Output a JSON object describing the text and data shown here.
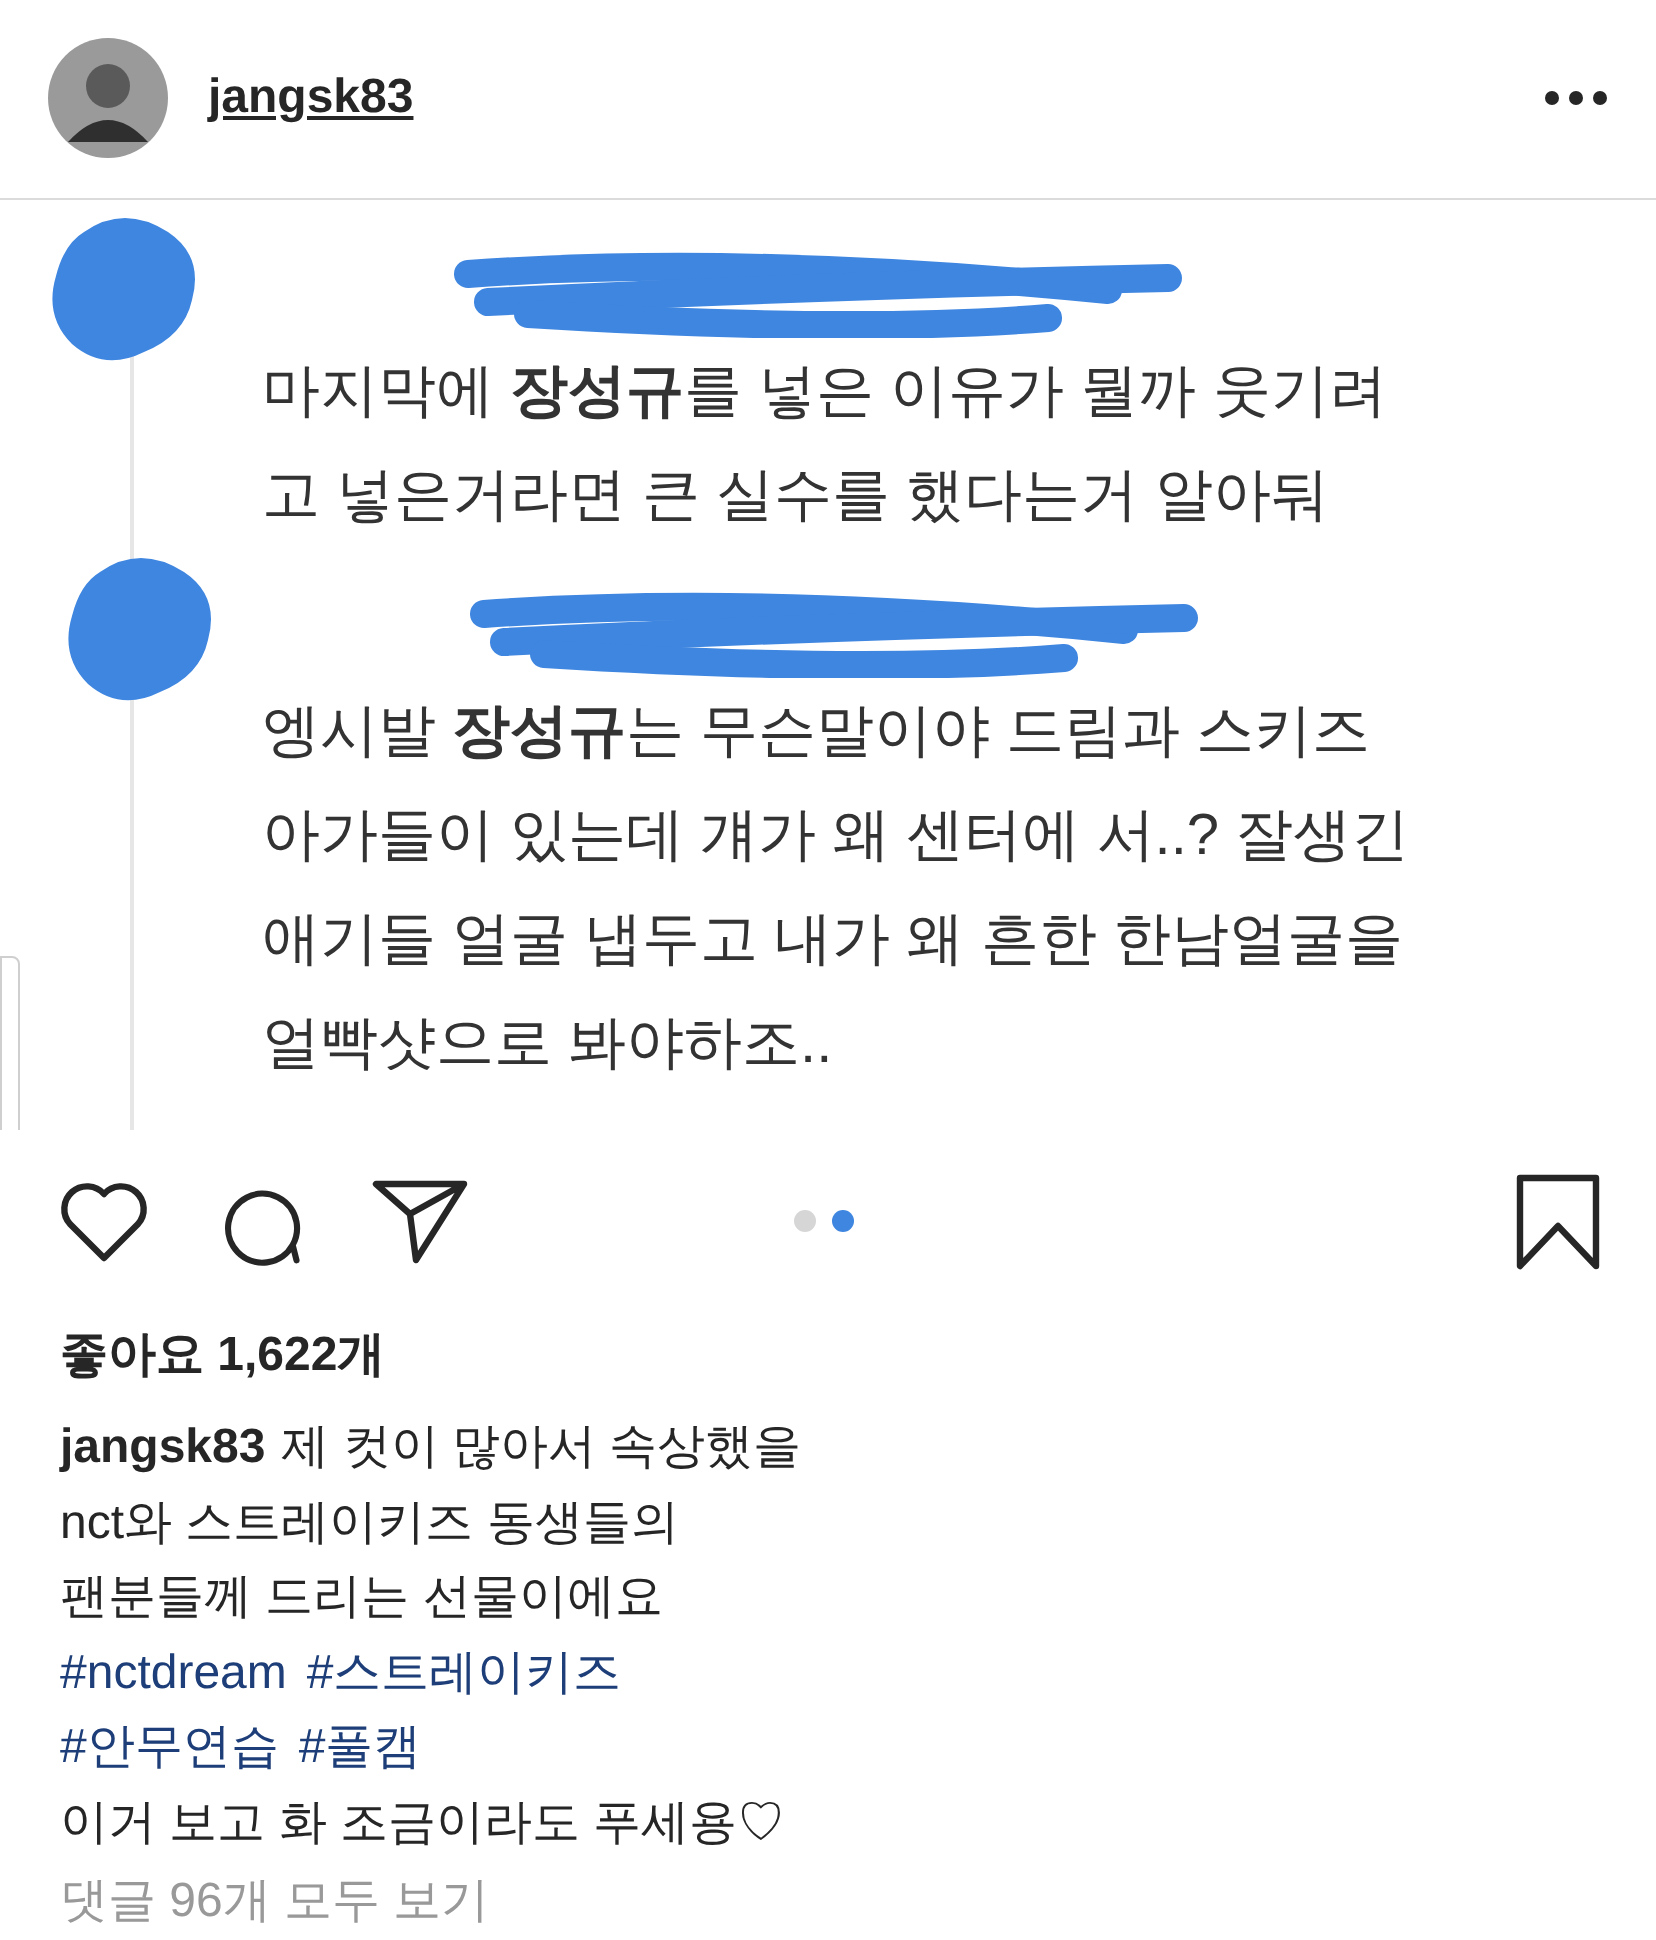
{
  "header": {
    "username": "jangsk83"
  },
  "post_image": {
    "comments": [
      {
        "lines": [
          "마지막에 **장성규**를 넣은 이유가 뭘까 웃기려",
          "고 넣은거라면 큰 실수를 했다는거 알아둬"
        ]
      },
      {
        "lines": [
          "엥시발 **장성규**는 무슨말이야 드림과 스키즈",
          "아가들이 있는데 걔가 왜 센터에 서..? 잘생긴",
          "애기들 얼굴 냅두고 내가 왜 흔한 한남얼굴을",
          "얼빡샷으로 봐야하조.."
        ]
      }
    ]
  },
  "carousel_dots": [
    {
      "selected": false
    },
    {
      "selected": true
    }
  ],
  "likes": "좋아요 1,622개",
  "caption": {
    "username": "jangsk83",
    "lines": [
      {
        "kind": "text",
        "text": "제 컷이 많아서 속상했을"
      },
      {
        "kind": "text",
        "text": "nct와 스트레이키즈 동생들의"
      },
      {
        "kind": "text",
        "text": "팬분들께 드리는 선물이에요"
      },
      {
        "kind": "hashtags",
        "tags": [
          "#nctdream",
          "#스트레이키즈"
        ]
      },
      {
        "kind": "hashtags",
        "tags": [
          "#안무연습",
          "#풀캠"
        ]
      },
      {
        "kind": "text",
        "text": "이거 보고 화 조금이라도 푸세용♡"
      }
    ]
  },
  "comments_link": "댓글 96개 모두 보기"
}
